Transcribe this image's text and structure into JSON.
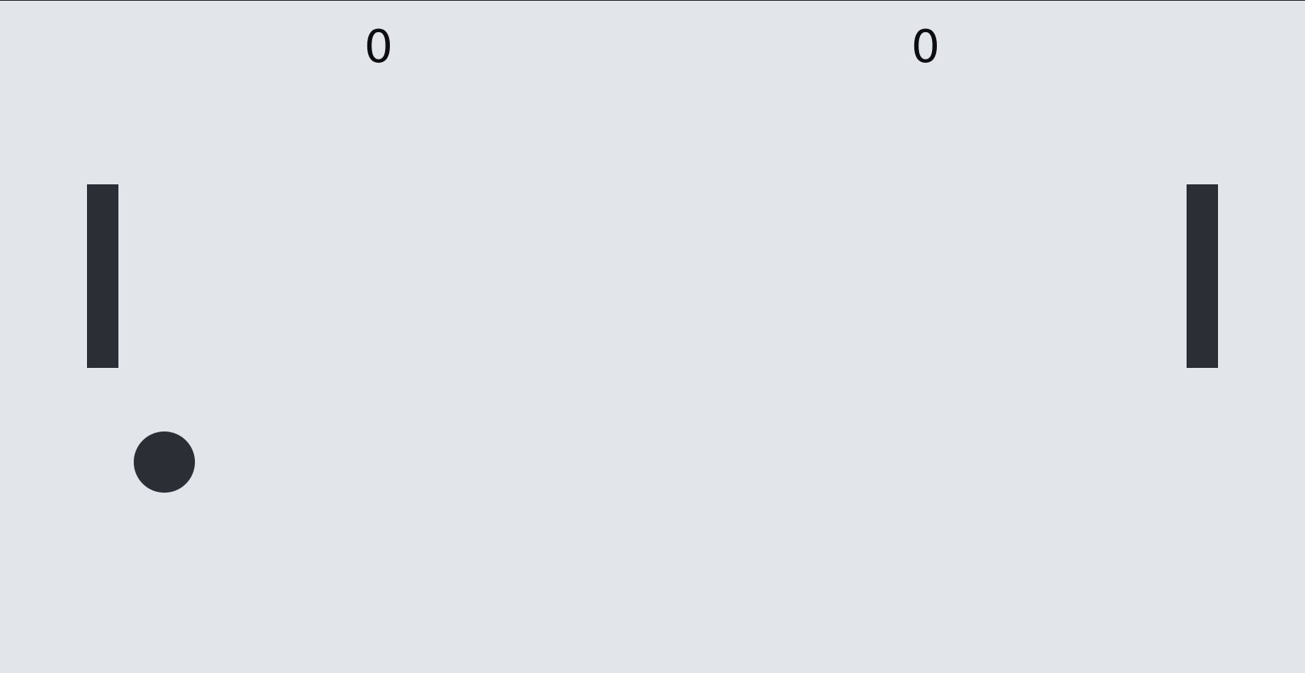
{
  "game": {
    "scores": {
      "left": "0",
      "right": "0"
    },
    "colors": {
      "background": "#e2e6eb",
      "paddle": "#2b2e35",
      "ball": "#2b2e35",
      "score_text": "#0c0d10"
    }
  }
}
